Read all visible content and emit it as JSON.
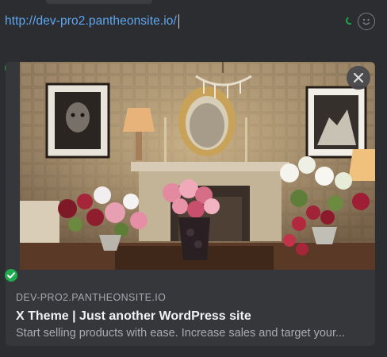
{
  "composer": {
    "url_text": "http://dev-pro2.pantheonsite.io/"
  },
  "link_preview": {
    "domain": "DEV-PRO2.PANTHEONSITE.IO",
    "title": "X Theme | Just another WordPress site",
    "description": "Start selling products with ease. Increase sales and target your..."
  },
  "icons": {
    "emoji": "smiley-face-icon",
    "close": "close-icon",
    "check": "check-icon",
    "spinner": "loading-spinner-icon"
  },
  "colors": {
    "link_blue": "#5ea7f2",
    "check_green": "#20a94f",
    "card_bg": "#36373b"
  }
}
